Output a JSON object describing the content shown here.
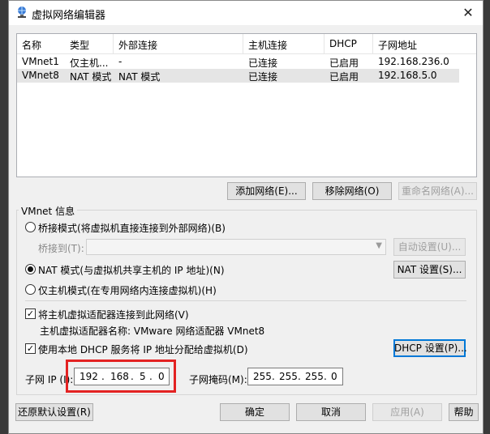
{
  "window": {
    "title": "虚拟网络编辑器",
    "close_glyph": "✕"
  },
  "columns": [
    "名称",
    "类型",
    "外部连接",
    "主机连接",
    "DHCP",
    "子网地址"
  ],
  "networks": [
    {
      "name": "VMnet1",
      "type": "仅主机...",
      "external": "-",
      "host": "已连接",
      "dhcp": "已启用",
      "subnet": "192.168.236.0"
    },
    {
      "name": "VMnet8",
      "type": "NAT 模式",
      "external": "NAT 模式",
      "host": "已连接",
      "dhcp": "已启用",
      "subnet": "192.168.5.0"
    }
  ],
  "list_buttons": {
    "add": "添加网络(E)...",
    "remove": "移除网络(O)",
    "rename": "重命名网络(A)..."
  },
  "info": {
    "group_label": "VMnet 信息",
    "bridge_mode": "桥接模式(将虚拟机直接连接到外部网络)(B)",
    "bridge_to_label": "桥接到(T):",
    "auto_settings": "自动设置(U)...",
    "nat_mode": "NAT 模式(与虚拟机共享主机的 IP 地址)(N)",
    "nat_settings": "NAT 设置(S)...",
    "host_only_mode": "仅主机模式(在专用网络内连接虚拟机)(H)",
    "connect_adapter": "将主机虚拟适配器连接到此网络(V)",
    "adapter_name": "主机虚拟适配器名称: VMware 网络适配器 VMnet8",
    "use_dhcp": "使用本地 DHCP 服务将 IP 地址分配给虚拟机(D)",
    "dhcp_settings": "DHCP 设置(P)...",
    "subnet_ip_label": "子网 IP (I):",
    "subnet_ip": [
      "192",
      "168",
      "5",
      "0"
    ],
    "subnet_mask_label": "子网掩码(M):",
    "subnet_mask": [
      "255",
      "255",
      "255",
      "0"
    ],
    "selected_mode": "nat",
    "connect_adapter_checked": true,
    "use_dhcp_checked": true
  },
  "footer_buttons": {
    "restore": "还原默认设置(R)",
    "ok": "确定",
    "cancel": "取消",
    "apply": "应用(A)",
    "help": "帮助"
  },
  "colors": {
    "highlight_box": "#e32222",
    "focus": "#0078d7"
  }
}
